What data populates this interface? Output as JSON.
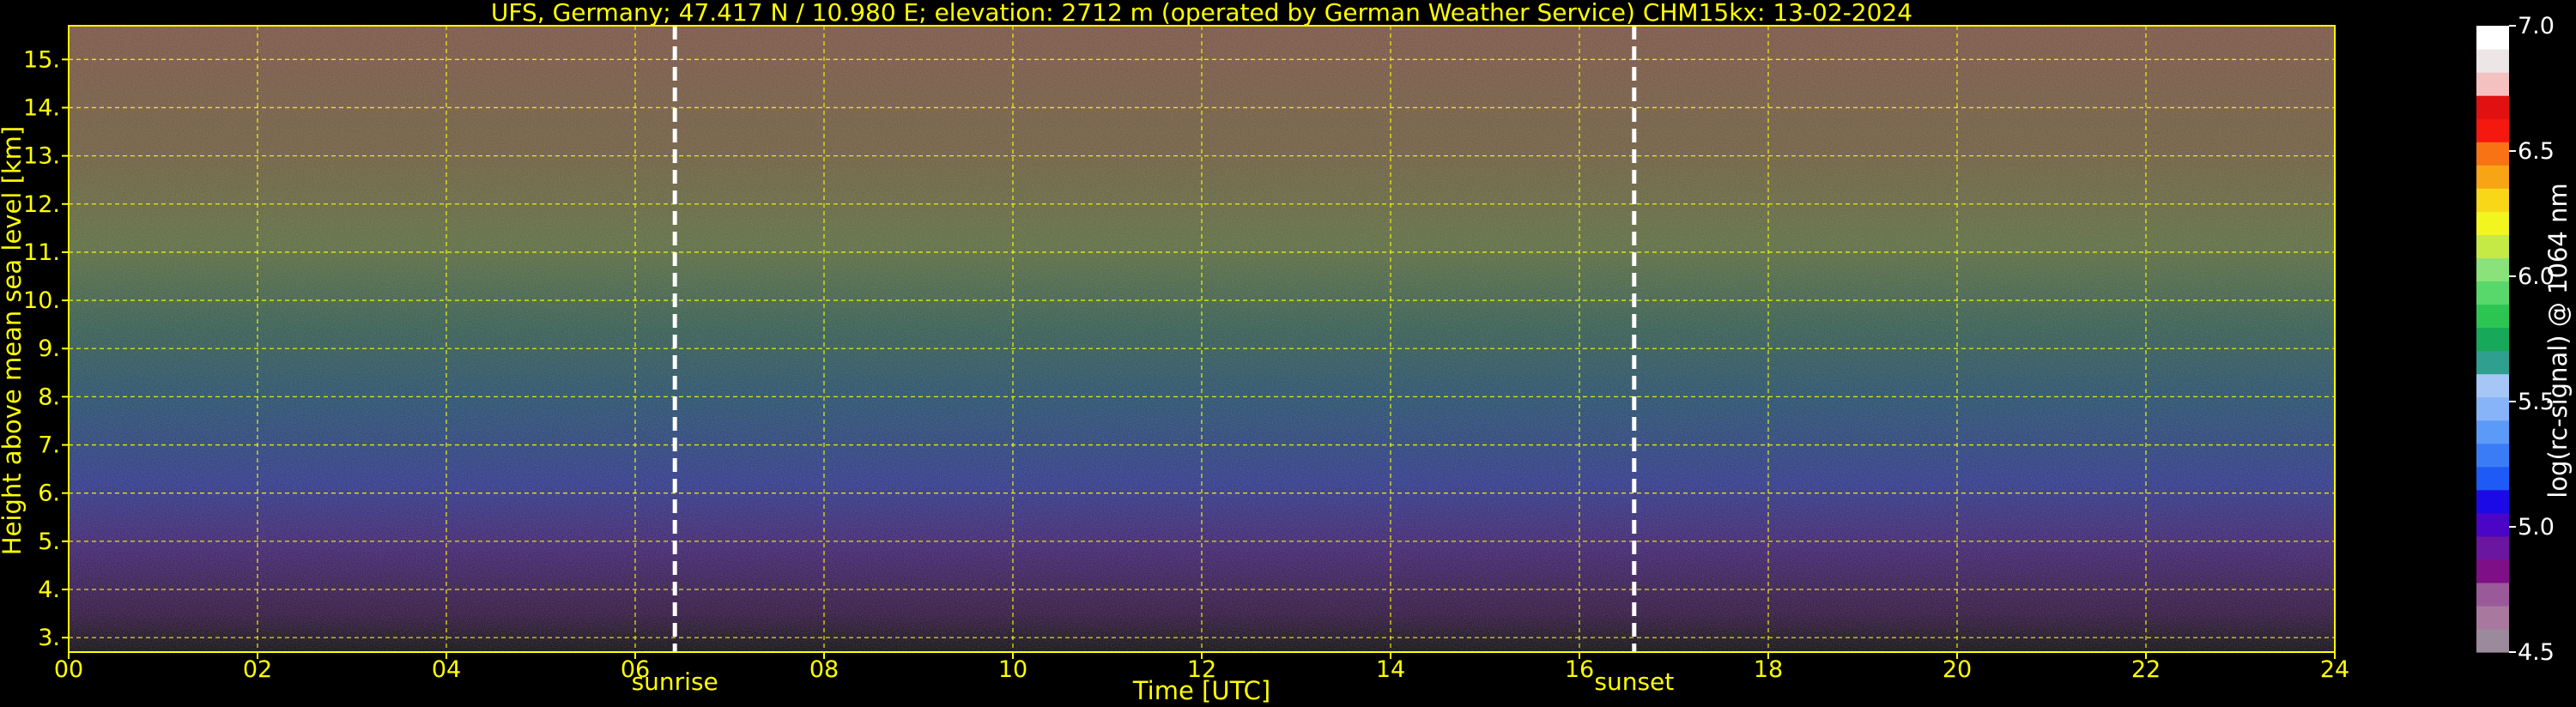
{
  "chart_data": {
    "type": "heatmap",
    "title": "UFS, Germany; 47.417 N / 10.980 E; elevation: 2712 m  (operated by German Weather Service)    CHM15kx: 13-02-2024",
    "xlabel": "Time [UTC]",
    "ylabel": "Height above mean sea level [km]",
    "xlim": [
      0,
      24
    ],
    "ylim": [
      2.7,
      15.7
    ],
    "x_ticks": [
      0,
      2,
      4,
      6,
      8,
      10,
      12,
      14,
      16,
      18,
      20,
      22,
      24
    ],
    "x_tick_labels": [
      "00",
      "02",
      "04",
      "06",
      "08",
      "10",
      "12",
      "14",
      "16",
      "18",
      "20",
      "22",
      "24"
    ],
    "y_ticks": [
      3,
      4,
      5,
      6,
      7,
      8,
      9,
      10,
      11,
      12,
      13,
      14,
      15
    ],
    "y_tick_labels": [
      "3.",
      "4.",
      "5.",
      "6.",
      "7.",
      "8.",
      "9.",
      "10.",
      "11.",
      "12.",
      "13.",
      "14.",
      "15."
    ],
    "grid": true,
    "grid_color": "#ffff00",
    "events": [
      {
        "label": "sunrise",
        "time": 6.42
      },
      {
        "label": "sunset",
        "time": 16.58
      }
    ],
    "colorbar": {
      "label": "log(rc-signal) @ 1064 nm",
      "range": [
        4.5,
        7.0
      ],
      "tick_values": [
        4.5,
        5.0,
        5.5,
        6.0,
        6.5,
        7.0
      ],
      "tick_labels": [
        "4.5",
        "5.0",
        "5.5",
        "6.0",
        "6.5",
        "7.0"
      ],
      "colors": [
        "#9b8a9b",
        "#a8789e",
        "#9a5a9a",
        "#7e0f87",
        "#6a16a0",
        "#4b05c7",
        "#1c0ae6",
        "#1e5af5",
        "#3a7cf5",
        "#5c9af7",
        "#87b4f8",
        "#a6c6f6",
        "#2f9f8f",
        "#18a85a",
        "#2cc552",
        "#58d86a",
        "#8ae37a",
        "#c6ea45",
        "#f3f51f",
        "#f8d618",
        "#f8a515",
        "#f77314",
        "#f4180f",
        "#e11111",
        "#f4c0c0",
        "#ece6e6",
        "#ffffff"
      ]
    }
  }
}
